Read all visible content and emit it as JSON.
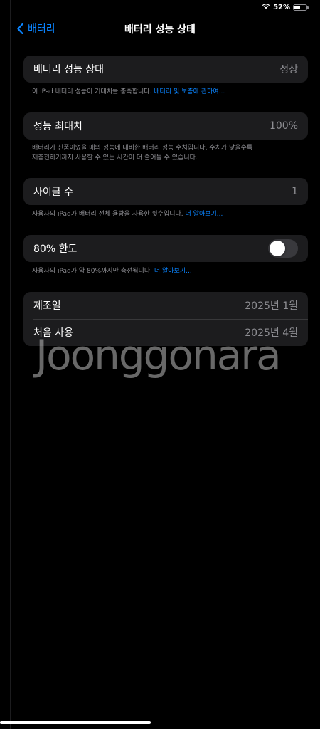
{
  "status_bar": {
    "battery_percent": "52%",
    "battery_level": 0.52,
    "wifi_icon": "wifi-icon",
    "battery_icon": "battery-icon"
  },
  "nav": {
    "back_label": "배터리",
    "title": "배터리 성능 상태",
    "back_icon": "chevron-left-icon"
  },
  "health": {
    "label": "배터리 성능 상태",
    "value": "정상",
    "footer_text": "이 iPad 배터리 성능이 기대치를 충족합니다. ",
    "footer_link": "배터리 및 보증에 관하여..."
  },
  "max_capacity": {
    "label": "성능 최대치",
    "value": "100%",
    "footer_line1": "배터리가 신품이었을 때의 성능에 대비한 배터리 성능 수치입니다. 수치가 낮을수록",
    "footer_line2": "재충전하기까지 사용할 수 있는 시간이 더 줄어들 수 있습니다."
  },
  "cycle_count": {
    "label": "사이클 수",
    "value": "1",
    "footer_text": "사용자의 iPad가 배터리 전체 용량을 사용한 횟수입니다. ",
    "footer_link": "더 알아보기..."
  },
  "limit_80": {
    "label": "80% 한도",
    "enabled": false,
    "footer_text": "사용자의 iPad가 약 80%까지만 충전됩니다. ",
    "footer_link": "더 알아보기..."
  },
  "dates": {
    "manufacture_label": "제조일",
    "manufacture_value": "2025년 1월",
    "first_use_label": "처음 사용",
    "first_use_value": "2025년 4월"
  },
  "watermark": "Joonggonara",
  "colors": {
    "background": "#000000",
    "cell": "#1c1c1e",
    "accent": "#0a84ff",
    "secondary_text": "#8e8e93"
  }
}
